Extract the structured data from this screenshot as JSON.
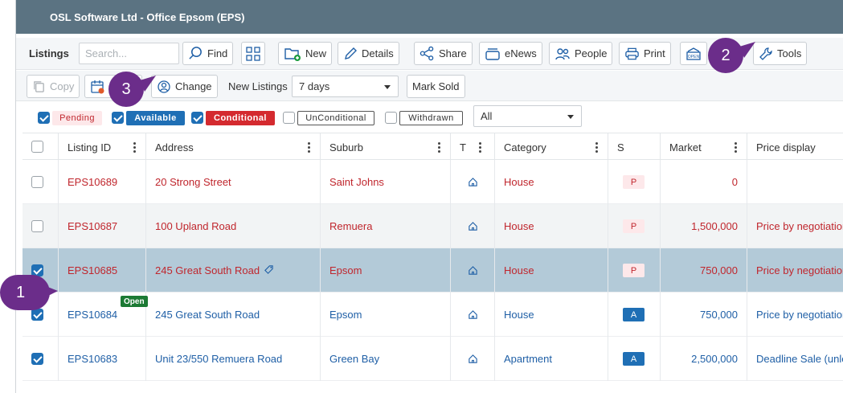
{
  "window": {
    "title": "OSL Software Ltd - Office Epsom (EPS)"
  },
  "toolbar": {
    "section_label": "Listings",
    "search_placeholder": "Search...",
    "find": "Find",
    "new": "New",
    "details": "Details",
    "share": "Share",
    "enews": "eNews",
    "people": "People",
    "print": "Print",
    "tools": "Tools"
  },
  "toolbar2": {
    "copy": "Copy",
    "change": "Change",
    "new_listings_label": "New Listings",
    "new_listings_value": "7 days",
    "mark_sold": "Mark Sold"
  },
  "filters": {
    "pending": {
      "label": "Pending",
      "checked": true
    },
    "available": {
      "label": "Available",
      "checked": true
    },
    "conditional": {
      "label": "Conditional",
      "checked": true
    },
    "unconditional": {
      "label": "UnConditional",
      "checked": false
    },
    "withdrawn": {
      "label": "Withdrawn",
      "checked": false
    },
    "dropdown_value": "All"
  },
  "columns": [
    "Listing ID",
    "Address",
    "Suburb",
    "T",
    "Category",
    "S",
    "Market",
    "Price display"
  ],
  "rows": [
    {
      "id": "EPS10689",
      "address": "20 Strong Street",
      "suburb": "Saint Johns",
      "category": "House",
      "status": "P",
      "market": "0",
      "price": "",
      "checked": false
    },
    {
      "id": "EPS10687",
      "address": "100 Upland Road",
      "suburb": "Remuera",
      "category": "House",
      "status": "P",
      "market": "1,500,000",
      "price": "Price by negotiation",
      "checked": false
    },
    {
      "id": "EPS10685",
      "address": "245 Great South Road",
      "suburb": "Epsom",
      "category": "House",
      "status": "P",
      "market": "750,000",
      "price": "Price by negotiation",
      "checked": true
    },
    {
      "id": "EPS10684",
      "address": "245 Great South Road",
      "suburb": "Epsom",
      "category": "House",
      "status": "A",
      "market": "750,000",
      "price": "Price by negotiation",
      "checked": true
    },
    {
      "id": "EPS10683",
      "address": "Unit 23/550 Remuera Road",
      "suburb": "Green Bay",
      "category": "Apartment",
      "status": "A",
      "market": "2,500,000",
      "price": "Deadline Sale (unles",
      "checked": true
    }
  ],
  "open_badge": "Open",
  "callouts": {
    "one": "1",
    "two": "2",
    "three": "3"
  },
  "colors": {
    "titlebar": "#5b7382",
    "pending_red": "#c0262d",
    "available_blue": "#1f6fb5",
    "selected_row": "#b3cad8",
    "callout_purple": "#6b2d8a"
  }
}
